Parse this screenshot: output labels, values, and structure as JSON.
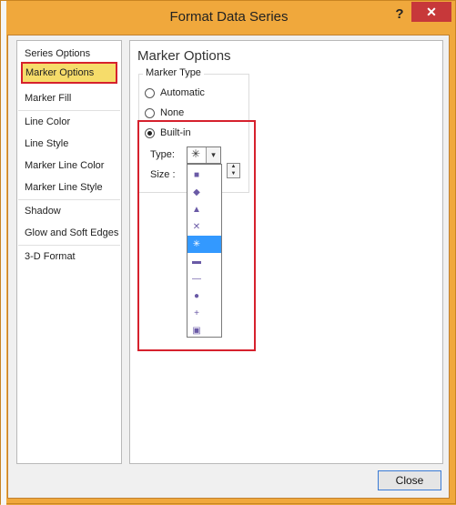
{
  "window": {
    "title": "Format Data Series",
    "help": "?",
    "close": "✕"
  },
  "nav": {
    "items": [
      {
        "label": "Series Options"
      },
      {
        "label": "Marker Options"
      },
      {
        "label": "Marker Fill"
      },
      {
        "label": "Line Color"
      },
      {
        "label": "Line Style"
      },
      {
        "label": "Marker Line Color"
      },
      {
        "label": "Marker Line Style"
      },
      {
        "label": "Shadow"
      },
      {
        "label": "Glow and Soft Edges"
      },
      {
        "label": "3-D Format"
      }
    ],
    "selected": "Marker Options"
  },
  "panel": {
    "title": "Marker Options",
    "group_label": "Marker Type",
    "options": {
      "automatic": "Automatic",
      "none": "None",
      "builtin": "Built-in"
    },
    "type_label": "Type:",
    "size_label": "Size :",
    "type_value": "✳",
    "combo_arrow": "▾"
  },
  "marker_list": [
    "■",
    "◆",
    "▲",
    "✕",
    "✳",
    "▬",
    "—",
    "●",
    "+",
    "▣"
  ],
  "marker_selected_index": 4,
  "buttons": {
    "close": "Close"
  }
}
